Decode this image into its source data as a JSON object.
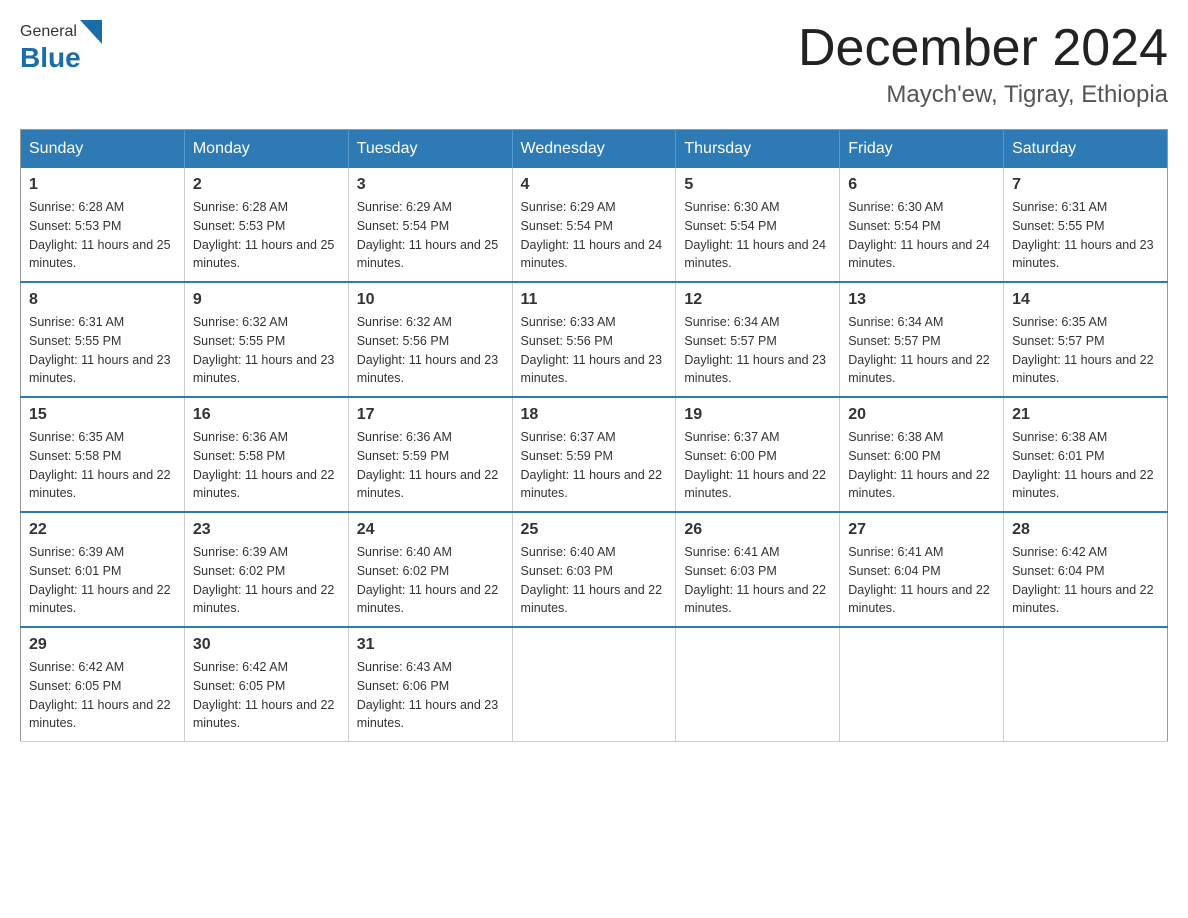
{
  "header": {
    "logo_general": "General",
    "logo_blue": "Blue",
    "month_year": "December 2024",
    "location": "Maych'ew, Tigray, Ethiopia"
  },
  "days_of_week": [
    "Sunday",
    "Monday",
    "Tuesday",
    "Wednesday",
    "Thursday",
    "Friday",
    "Saturday"
  ],
  "weeks": [
    [
      {
        "day": "1",
        "sunrise": "6:28 AM",
        "sunset": "5:53 PM",
        "daylight": "11 hours and 25 minutes."
      },
      {
        "day": "2",
        "sunrise": "6:28 AM",
        "sunset": "5:53 PM",
        "daylight": "11 hours and 25 minutes."
      },
      {
        "day": "3",
        "sunrise": "6:29 AM",
        "sunset": "5:54 PM",
        "daylight": "11 hours and 25 minutes."
      },
      {
        "day": "4",
        "sunrise": "6:29 AM",
        "sunset": "5:54 PM",
        "daylight": "11 hours and 24 minutes."
      },
      {
        "day": "5",
        "sunrise": "6:30 AM",
        "sunset": "5:54 PM",
        "daylight": "11 hours and 24 minutes."
      },
      {
        "day": "6",
        "sunrise": "6:30 AM",
        "sunset": "5:54 PM",
        "daylight": "11 hours and 24 minutes."
      },
      {
        "day": "7",
        "sunrise": "6:31 AM",
        "sunset": "5:55 PM",
        "daylight": "11 hours and 23 minutes."
      }
    ],
    [
      {
        "day": "8",
        "sunrise": "6:31 AM",
        "sunset": "5:55 PM",
        "daylight": "11 hours and 23 minutes."
      },
      {
        "day": "9",
        "sunrise": "6:32 AM",
        "sunset": "5:55 PM",
        "daylight": "11 hours and 23 minutes."
      },
      {
        "day": "10",
        "sunrise": "6:32 AM",
        "sunset": "5:56 PM",
        "daylight": "11 hours and 23 minutes."
      },
      {
        "day": "11",
        "sunrise": "6:33 AM",
        "sunset": "5:56 PM",
        "daylight": "11 hours and 23 minutes."
      },
      {
        "day": "12",
        "sunrise": "6:34 AM",
        "sunset": "5:57 PM",
        "daylight": "11 hours and 23 minutes."
      },
      {
        "day": "13",
        "sunrise": "6:34 AM",
        "sunset": "5:57 PM",
        "daylight": "11 hours and 22 minutes."
      },
      {
        "day": "14",
        "sunrise": "6:35 AM",
        "sunset": "5:57 PM",
        "daylight": "11 hours and 22 minutes."
      }
    ],
    [
      {
        "day": "15",
        "sunrise": "6:35 AM",
        "sunset": "5:58 PM",
        "daylight": "11 hours and 22 minutes."
      },
      {
        "day": "16",
        "sunrise": "6:36 AM",
        "sunset": "5:58 PM",
        "daylight": "11 hours and 22 minutes."
      },
      {
        "day": "17",
        "sunrise": "6:36 AM",
        "sunset": "5:59 PM",
        "daylight": "11 hours and 22 minutes."
      },
      {
        "day": "18",
        "sunrise": "6:37 AM",
        "sunset": "5:59 PM",
        "daylight": "11 hours and 22 minutes."
      },
      {
        "day": "19",
        "sunrise": "6:37 AM",
        "sunset": "6:00 PM",
        "daylight": "11 hours and 22 minutes."
      },
      {
        "day": "20",
        "sunrise": "6:38 AM",
        "sunset": "6:00 PM",
        "daylight": "11 hours and 22 minutes."
      },
      {
        "day": "21",
        "sunrise": "6:38 AM",
        "sunset": "6:01 PM",
        "daylight": "11 hours and 22 minutes."
      }
    ],
    [
      {
        "day": "22",
        "sunrise": "6:39 AM",
        "sunset": "6:01 PM",
        "daylight": "11 hours and 22 minutes."
      },
      {
        "day": "23",
        "sunrise": "6:39 AM",
        "sunset": "6:02 PM",
        "daylight": "11 hours and 22 minutes."
      },
      {
        "day": "24",
        "sunrise": "6:40 AM",
        "sunset": "6:02 PM",
        "daylight": "11 hours and 22 minutes."
      },
      {
        "day": "25",
        "sunrise": "6:40 AM",
        "sunset": "6:03 PM",
        "daylight": "11 hours and 22 minutes."
      },
      {
        "day": "26",
        "sunrise": "6:41 AM",
        "sunset": "6:03 PM",
        "daylight": "11 hours and 22 minutes."
      },
      {
        "day": "27",
        "sunrise": "6:41 AM",
        "sunset": "6:04 PM",
        "daylight": "11 hours and 22 minutes."
      },
      {
        "day": "28",
        "sunrise": "6:42 AM",
        "sunset": "6:04 PM",
        "daylight": "11 hours and 22 minutes."
      }
    ],
    [
      {
        "day": "29",
        "sunrise": "6:42 AM",
        "sunset": "6:05 PM",
        "daylight": "11 hours and 22 minutes."
      },
      {
        "day": "30",
        "sunrise": "6:42 AM",
        "sunset": "6:05 PM",
        "daylight": "11 hours and 22 minutes."
      },
      {
        "day": "31",
        "sunrise": "6:43 AM",
        "sunset": "6:06 PM",
        "daylight": "11 hours and 23 minutes."
      },
      null,
      null,
      null,
      null
    ]
  ],
  "labels": {
    "sunrise": "Sunrise: ",
    "sunset": "Sunset: ",
    "daylight": "Daylight: "
  }
}
